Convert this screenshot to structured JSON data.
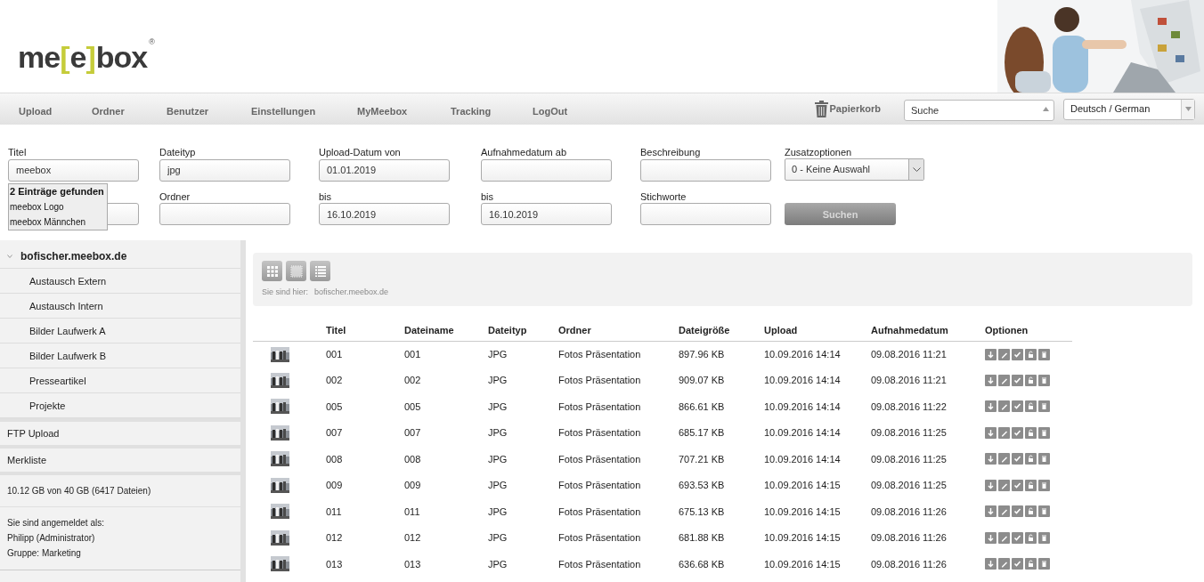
{
  "logo": {
    "parts": [
      {
        "kind": "plain",
        "text": "me"
      },
      {
        "kind": "accent",
        "text": "["
      },
      {
        "kind": "plain",
        "text": "e"
      },
      {
        "kind": "accent",
        "text": "]"
      },
      {
        "kind": "plain",
        "text": "box"
      },
      {
        "kind": "mark",
        "text": "®"
      }
    ]
  },
  "header_picture": {
    "kind": "picture"
  },
  "nav": {
    "items": [
      "Upload",
      "Ordner",
      "Benutzer",
      "Einstellungen",
      "MyMeebox",
      "Tracking",
      "LogOut"
    ],
    "trash": "Papierkorb",
    "search": {
      "placeholder": "Suche"
    },
    "language": "Deutsch / German"
  },
  "filters": [
    [
      {
        "kind": "input",
        "label": "Titel",
        "value": "meebox"
      },
      {
        "kind": "input",
        "label": "Dateityp",
        "value": "jpg"
      },
      {
        "kind": "input",
        "label": "Upload-Datum von",
        "value": "01.01.2019"
      },
      {
        "kind": "input",
        "label": "Aufnahmedatum ab"
      },
      {
        "kind": "input",
        "label": "Beschreibung"
      },
      {
        "kind": "select",
        "label": "Zusatzoptionen",
        "value": "0 - Keine Auswahl"
      }
    ],
    [
      {
        "kind": "input"
      },
      {
        "kind": "input",
        "label": "Ordner"
      },
      {
        "kind": "input",
        "label": "bis",
        "value": "16.10.2019"
      },
      {
        "kind": "input",
        "label": "bis",
        "value": "16.10.2019"
      },
      {
        "kind": "input",
        "label": "Stichworte"
      },
      {
        "kind": "button",
        "text": "Suchen"
      }
    ]
  ],
  "autocomplete": {
    "heading": "2 Einträge gefunden",
    "items": [
      "meebox Logo",
      "meebox Männchen"
    ]
  },
  "sidebar": {
    "tree": {
      "label": "bofischer.meebox.de",
      "expanded": true,
      "children": [
        {
          "label": "Austausch Extern"
        },
        {
          "label": "Austausch Intern"
        },
        {
          "label": "Bilder Laufwerk A"
        },
        {
          "label": "Bilder Laufwerk B"
        },
        {
          "label": "Presseartikel"
        },
        {
          "label": "Projekte"
        }
      ]
    },
    "sections": [
      "FTP Upload",
      "Merkliste"
    ],
    "storage": "10.12 GB von 40 GB (6417 Dateien)",
    "login": [
      "Sie sind angemeldet als:",
      "Philipp (Administrator)",
      "Gruppe: Marketing"
    ]
  },
  "toolbar": {
    "breadcrumb_label": "Sie sind hier:",
    "breadcrumb": "bofischer.meebox.de"
  },
  "table": {
    "columns": [
      "Titel",
      "Dateiname",
      "Dateityp",
      "Ordner",
      "Dateigröße",
      "Upload",
      "Aufnahmedatum",
      "Optionen"
    ],
    "rows": [
      [
        "001",
        "001",
        "JPG",
        "Fotos Präsentation",
        "897.96 KB",
        "10.09.2016 14:14",
        "09.08.2016 11:21"
      ],
      [
        "002",
        "002",
        "JPG",
        "Fotos Präsentation",
        "909.07 KB",
        "10.09.2016 14:14",
        "09.08.2016 11:21"
      ],
      [
        "005",
        "005",
        "JPG",
        "Fotos Präsentation",
        "866.61 KB",
        "10.09.2016 14:14",
        "09.08.2016 11:22"
      ],
      [
        "007",
        "007",
        "JPG",
        "Fotos Präsentation",
        "685.17 KB",
        "10.09.2016 14:14",
        "09.08.2016 11:25"
      ],
      [
        "008",
        "008",
        "JPG",
        "Fotos Präsentation",
        "707.21 KB",
        "10.09.2016 14:14",
        "09.08.2016 11:25"
      ],
      [
        "009",
        "009",
        "JPG",
        "Fotos Präsentation",
        "693.53 KB",
        "10.09.2016 14:15",
        "09.08.2016 11:25"
      ],
      [
        "011",
        "011",
        "JPG",
        "Fotos Präsentation",
        "675.13 KB",
        "10.09.2016 14:15",
        "09.08.2016 11:26"
      ],
      [
        "012",
        "012",
        "JPG",
        "Fotos Präsentation",
        "681.88 KB",
        "10.09.2016 14:15",
        "09.08.2016 11:26"
      ],
      [
        "013",
        "013",
        "JPG",
        "Fotos Präsentation",
        "636.68 KB",
        "10.09.2016 14:15",
        "09.08.2016 11:26"
      ]
    ]
  }
}
